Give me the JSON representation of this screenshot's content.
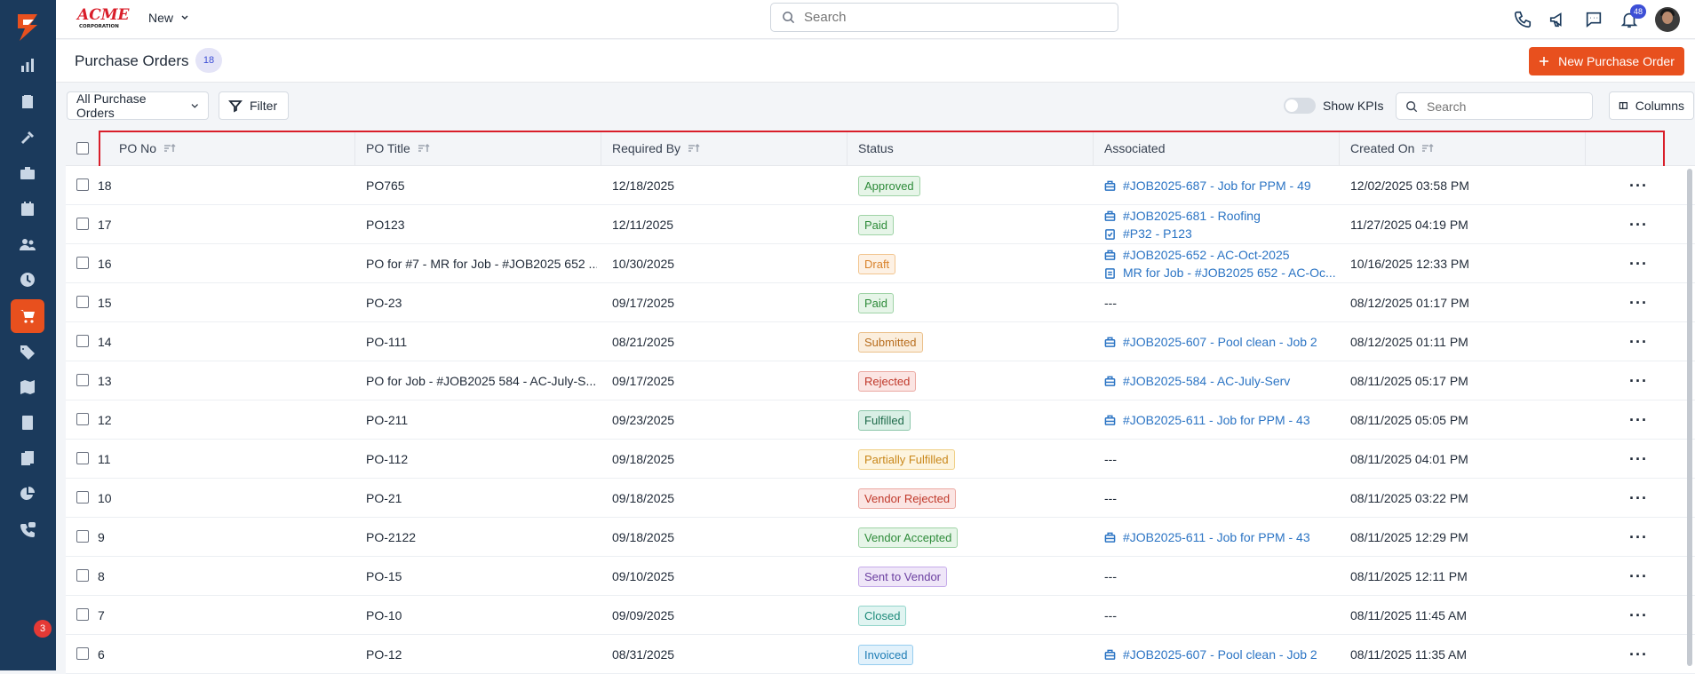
{
  "topbar": {
    "brand_name": "ACME CORPORATION",
    "new_label": "New",
    "search_placeholder": "Search",
    "notification_count": "48"
  },
  "sidebar": {
    "call_badge_count": "3",
    "items": [
      {
        "icon": "chart-bar-icon"
      },
      {
        "icon": "clipboard-icon"
      },
      {
        "icon": "tools-icon"
      },
      {
        "icon": "briefcase-icon"
      },
      {
        "icon": "calendar-icon"
      },
      {
        "icon": "users-icon"
      },
      {
        "icon": "clock-icon"
      },
      {
        "icon": "cart-icon",
        "active": true
      },
      {
        "icon": "tag-icon"
      },
      {
        "icon": "map-icon"
      },
      {
        "icon": "calculator-icon"
      },
      {
        "icon": "documents-icon"
      },
      {
        "icon": "pie-chart-icon"
      },
      {
        "icon": "phone-chat-icon"
      }
    ]
  },
  "page": {
    "title": "Purchase Orders",
    "count": "18",
    "new_button_label": "New Purchase Order"
  },
  "toolbar": {
    "view_label": "All Purchase Orders",
    "filter_label": "Filter",
    "kpi_label": "Show KPIs",
    "search_placeholder": "Search",
    "columns_label": "Columns"
  },
  "table": {
    "columns": [
      "PO No",
      "PO Title",
      "Required By",
      "Status",
      "Associated",
      "Created On"
    ],
    "rows": [
      {
        "po_no": "18",
        "title": "PO765",
        "required_by": "12/18/2025",
        "status": "Approved",
        "assoc": [
          {
            "icon": "briefcase-icon",
            "text": "#JOB2025-687 - Job for PPM - 49"
          }
        ],
        "created_on": "12/02/2025 03:58 PM"
      },
      {
        "po_no": "17",
        "title": "PO123",
        "required_by": "12/11/2025",
        "status": "Paid",
        "assoc": [
          {
            "icon": "briefcase-icon",
            "text": "#JOB2025-681 - Roofing"
          },
          {
            "icon": "clipboard-check-icon",
            "text": "#P32 - P123"
          }
        ],
        "created_on": "11/27/2025 04:19 PM"
      },
      {
        "po_no": "16",
        "title": "PO for #7 - MR for Job - #JOB2025 652 ...",
        "required_by": "10/30/2025",
        "status": "Draft",
        "assoc": [
          {
            "icon": "briefcase-icon",
            "text": "#JOB2025-652 - AC-Oct-2025"
          },
          {
            "icon": "clipboard-list-icon",
            "text": "MR for Job - #JOB2025 652 - AC-Oc..."
          }
        ],
        "created_on": "10/16/2025 12:33 PM"
      },
      {
        "po_no": "15",
        "title": "PO-23",
        "required_by": "09/17/2025",
        "status": "Paid",
        "assoc_text": "---",
        "created_on": "08/12/2025 01:17 PM"
      },
      {
        "po_no": "14",
        "title": "PO-111",
        "required_by": "08/21/2025",
        "status": "Submitted",
        "assoc": [
          {
            "icon": "briefcase-icon",
            "text": "#JOB2025-607 - Pool clean - Job 2"
          }
        ],
        "created_on": "08/12/2025 01:11 PM"
      },
      {
        "po_no": "13",
        "title": "PO for Job - #JOB2025 584 - AC-July-S...",
        "required_by": "09/17/2025",
        "status": "Rejected",
        "assoc": [
          {
            "icon": "briefcase-icon",
            "text": "#JOB2025-584 - AC-July-Serv"
          }
        ],
        "created_on": "08/11/2025 05:17 PM"
      },
      {
        "po_no": "12",
        "title": "PO-211",
        "required_by": "09/23/2025",
        "status": "Fulfilled",
        "assoc": [
          {
            "icon": "briefcase-icon",
            "text": "#JOB2025-611 - Job for PPM - 43"
          }
        ],
        "created_on": "08/11/2025 05:05 PM"
      },
      {
        "po_no": "11",
        "title": "PO-112",
        "required_by": "09/18/2025",
        "status": "Partially Fulfilled",
        "assoc_text": "---",
        "created_on": "08/11/2025 04:01 PM"
      },
      {
        "po_no": "10",
        "title": "PO-21",
        "required_by": "09/18/2025",
        "status": "Vendor Rejected",
        "assoc_text": "---",
        "created_on": "08/11/2025 03:22 PM"
      },
      {
        "po_no": "9",
        "title": "PO-2122",
        "required_by": "09/18/2025",
        "status": "Vendor Accepted",
        "assoc": [
          {
            "icon": "briefcase-icon",
            "text": "#JOB2025-611 - Job for PPM - 43"
          }
        ],
        "created_on": "08/11/2025 12:29 PM"
      },
      {
        "po_no": "8",
        "title": "PO-15",
        "required_by": "09/10/2025",
        "status": "Sent to Vendor",
        "assoc_text": "---",
        "created_on": "08/11/2025 12:11 PM"
      },
      {
        "po_no": "7",
        "title": "PO-10",
        "required_by": "09/09/2025",
        "status": "Closed",
        "assoc_text": "---",
        "created_on": "08/11/2025 11:45 AM"
      },
      {
        "po_no": "6",
        "title": "PO-12",
        "required_by": "08/31/2025",
        "status": "Invoiced",
        "assoc": [
          {
            "icon": "briefcase-icon",
            "text": "#JOB2025-607 - Pool clean - Job 2"
          }
        ],
        "created_on": "08/11/2025 11:35 AM"
      }
    ]
  },
  "status_colors": {
    "Approved": {
      "fg": "#2e8b3a",
      "bg": "#e6f5e8",
      "border": "#9fd3a6"
    },
    "Paid": {
      "fg": "#2e8b3a",
      "bg": "#e6f5e8",
      "border": "#9fd3a6"
    },
    "Draft": {
      "fg": "#d9822b",
      "bg": "#fdf1e4",
      "border": "#f2c58f"
    },
    "Submitted": {
      "fg": "#b86e1f",
      "bg": "#fbeedd",
      "border": "#ebc08a"
    },
    "Rejected": {
      "fg": "#c0392b",
      "bg": "#fbe5e3",
      "border": "#eba9a2"
    },
    "Fulfilled": {
      "fg": "#1e6b4a",
      "bg": "#d9efe5",
      "border": "#8cc7ab"
    },
    "Partially Fulfilled": {
      "fg": "#c9871a",
      "bg": "#fdf4de",
      "border": "#efcf85"
    },
    "Vendor Rejected": {
      "fg": "#c0392b",
      "bg": "#fbe5e3",
      "border": "#eba9a2"
    },
    "Vendor Accepted": {
      "fg": "#2e8b3a",
      "bg": "#e6f5e8",
      "border": "#9fd3a6"
    },
    "Sent to Vendor": {
      "fg": "#6b3fa0",
      "bg": "#efe6f8",
      "border": "#c6acea"
    },
    "Closed": {
      "fg": "#1e8a7a",
      "bg": "#e0f4f1",
      "border": "#93d5cb"
    },
    "Invoiced": {
      "fg": "#1f7db5",
      "bg": "#e1f1fb",
      "border": "#96cdef"
    }
  },
  "colors": {
    "accent": "#e8501e",
    "sidebar": "#1b3a5c",
    "link": "#2b74c4",
    "highlight": "#d91e2a"
  }
}
